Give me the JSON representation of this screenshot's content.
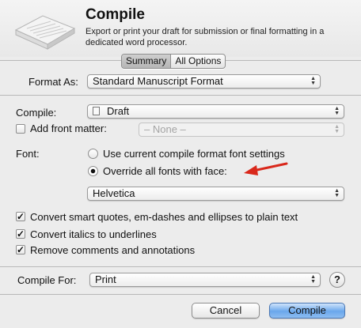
{
  "header": {
    "title": "Compile",
    "description": "Export or print your draft for submission or final formatting in a dedicated word processor."
  },
  "tabs": [
    {
      "label": "Summary",
      "selected": true
    },
    {
      "label": "All Options",
      "selected": false
    }
  ],
  "format_as": {
    "label": "Format As:",
    "value": "Standard Manuscript Format"
  },
  "compile": {
    "label": "Compile:",
    "value": "Draft"
  },
  "front_matter": {
    "label": "Add front matter:",
    "checked": false,
    "value": "– None –"
  },
  "font": {
    "label": "Font:",
    "option_current": {
      "label": "Use current compile format font settings",
      "selected": false
    },
    "option_override": {
      "label": "Override all fonts with face:",
      "selected": true
    },
    "face": "Helvetica"
  },
  "checkboxes": [
    {
      "label": "Convert smart quotes, em-dashes and ellipses to plain text",
      "checked": true
    },
    {
      "label": "Convert italics to underlines",
      "checked": true
    },
    {
      "label": "Remove comments and annotations",
      "checked": true
    }
  ],
  "compile_for": {
    "label": "Compile For:",
    "value": "Print"
  },
  "buttons": {
    "help": "?",
    "cancel": "Cancel",
    "compile": "Compile"
  },
  "colors": {
    "annotation_arrow": "#d9281b",
    "primary_button": "#6aa7ec"
  }
}
